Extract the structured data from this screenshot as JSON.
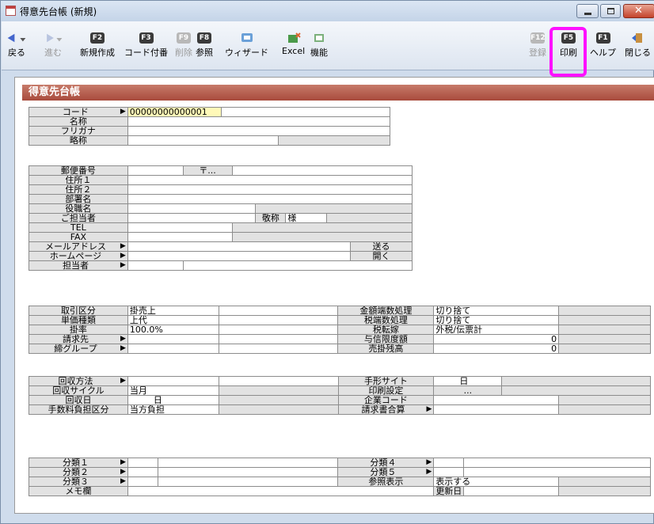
{
  "window": {
    "title": "得意先台帳 (新規)"
  },
  "toolbar": {
    "back": "戻る",
    "forward": "進む",
    "new": "新規作成",
    "code": "コード付番",
    "delete": "削除",
    "ref": "参照",
    "wizard": "ウィザード",
    "excel": "Excel",
    "func": "機能",
    "register": "登録",
    "print": "印刷",
    "help": "ヘルプ",
    "close": "閉じる",
    "k_f2": "F2",
    "k_f3": "F3",
    "k_f9": "F9",
    "k_f8": "F8",
    "k_f12": "F12",
    "k_f5": "F5",
    "k_f1": "F1"
  },
  "header": "得意先台帳",
  "s1": {
    "code_l": "コード",
    "code_v": "00000000000001",
    "name_l": "名称",
    "kana_l": "フリガナ",
    "short_l": "略称"
  },
  "s2": {
    "zip_l": "郵便番号",
    "zip_btn": "〒...",
    "addr1_l": "住所１",
    "addr2_l": "住所２",
    "dept_l": "部署名",
    "pos_l": "役職名",
    "person_l": "ご担当者",
    "honor_l": "敬称",
    "honor_v": "様",
    "tel_l": "TEL",
    "fax_l": "FAX",
    "mail_l": "メールアドレス",
    "send_btn": "送る",
    "hp_l": "ホームページ",
    "open_btn": "開く",
    "staff_l": "担当者"
  },
  "s3": {
    "trade_l": "取引区分",
    "trade_v": "掛売上",
    "price_l": "単価種類",
    "price_v": "上代",
    "rate_l": "掛率",
    "rate_v": "100.0",
    "rate_u": "%",
    "bill_l": "請求先",
    "close_l": "締グループ",
    "round_l": "金額端数処理",
    "round_v": "切り捨て",
    "tax_round_l": "税端数処理",
    "tax_round_v": "切り捨て",
    "tax_l": "税転嫁",
    "tax_v": "外税/伝票計",
    "credit_l": "与信限度額",
    "credit_v": "0",
    "balance_l": "売掛残高",
    "balance_v": "0"
  },
  "s4": {
    "method_l": "回収方法",
    "cycle_l": "回収サイクル",
    "cycle_v": "当月",
    "day_l": "回収日",
    "day_u": "日",
    "fee_l": "手数料負担区分",
    "fee_v": "当方負担",
    "bill_site_l": "手形サイト",
    "bill_site_u": "日",
    "print_l": "印刷設定",
    "print_btn": "...",
    "corp_l": "企業コード",
    "inv_l": "請求書合算"
  },
  "s5": {
    "c1": "分類１",
    "c2": "分類２",
    "c3": "分類３",
    "c4": "分類４",
    "c5": "分類５",
    "refdisp_l": "参照表示",
    "refdisp_v": "表示する",
    "memo_l": "メモ欄",
    "updated_l": "更新日"
  }
}
